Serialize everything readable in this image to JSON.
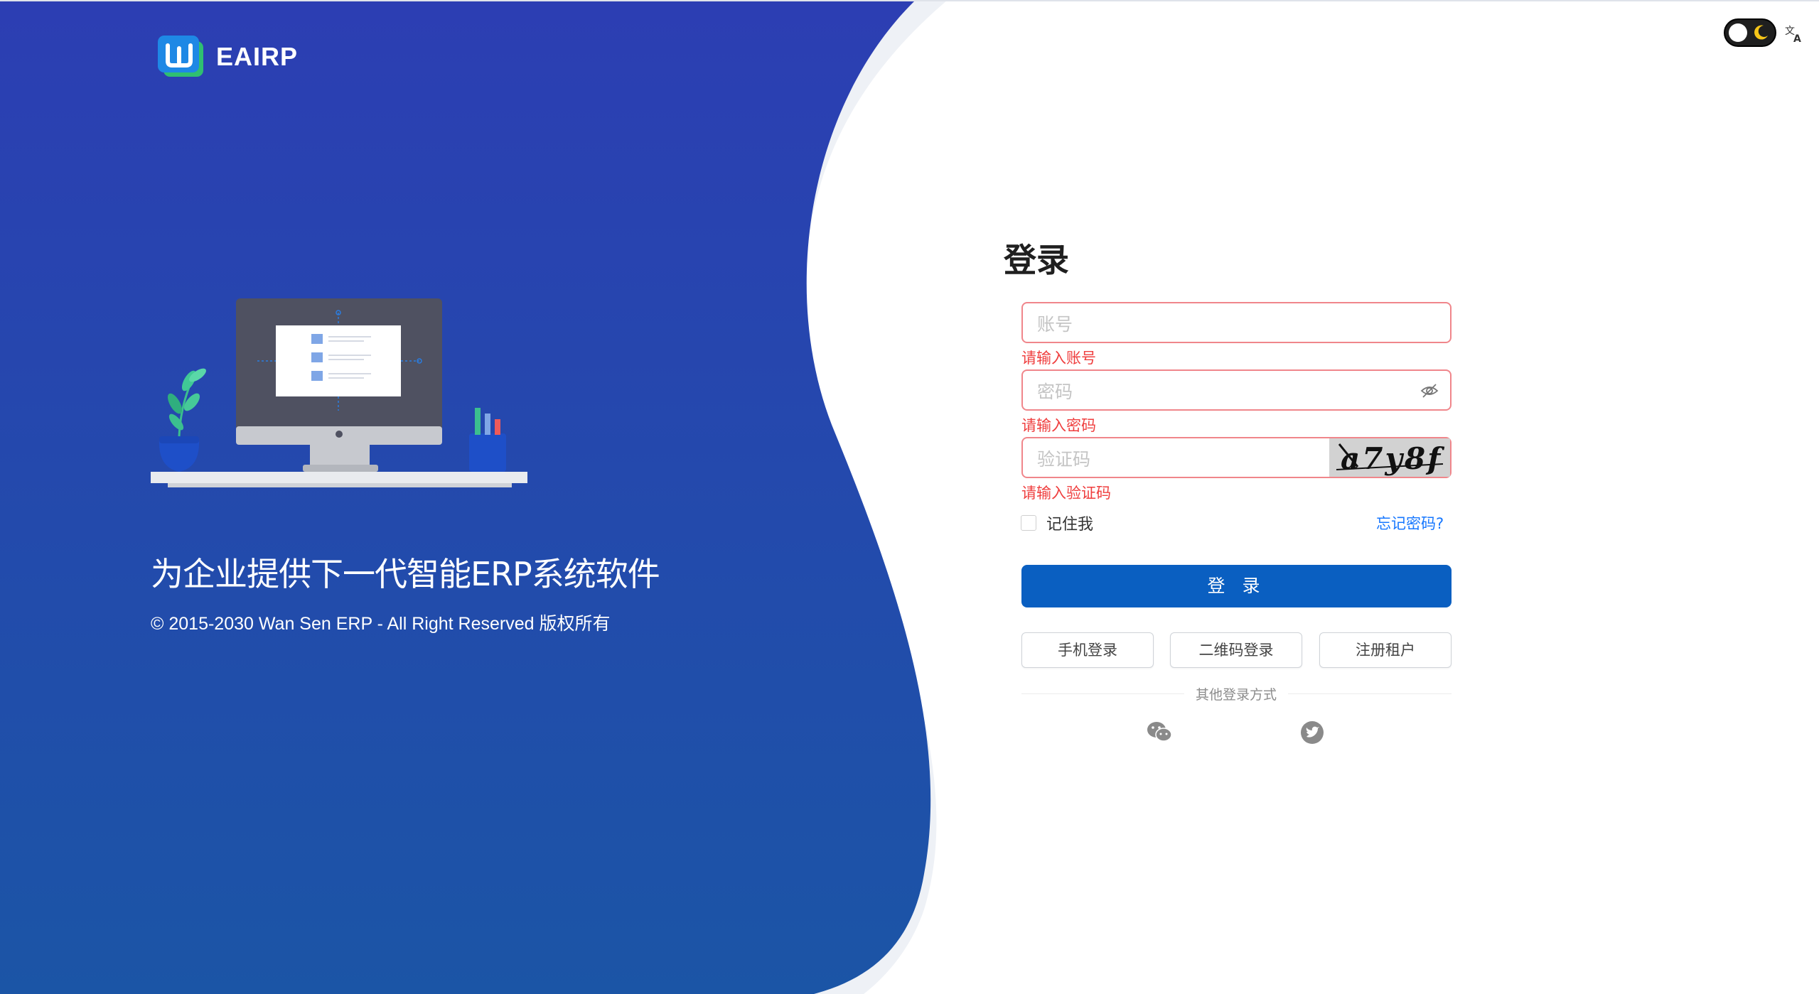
{
  "brand": {
    "name": "EAIRP"
  },
  "hero": {
    "slogan": "为企业提供下一代智能ERP系统软件",
    "copyright": "© 2015-2030 Wan Sen ERP - All Right Reserved 版权所有"
  },
  "header": {
    "theme_toggle_icon": "moon-icon",
    "language_icon": "translate-icon"
  },
  "login": {
    "title": "登录",
    "username": {
      "placeholder": "账号",
      "value": "",
      "error": "请输入账号"
    },
    "password": {
      "placeholder": "密码",
      "value": "",
      "error": "请输入密码"
    },
    "captcha": {
      "placeholder": "验证码",
      "value": "",
      "error": "请输入验证码",
      "image_text": "a7y8f"
    },
    "remember_label": "记住我",
    "forgot_label": "忘记密码?",
    "submit_label": "登 录",
    "alt_buttons": {
      "phone": "手机登录",
      "qrcode": "二维码登录",
      "register": "注册租户"
    },
    "other_methods_label": "其他登录方式",
    "social": [
      "wechat-icon",
      "twitter-icon"
    ]
  },
  "colors": {
    "hero_top": "#2c3eb3",
    "hero_bottom": "#1b55a6",
    "primary": "#0a5fc1",
    "error": "#ef3e3e",
    "link": "#1677ff"
  }
}
